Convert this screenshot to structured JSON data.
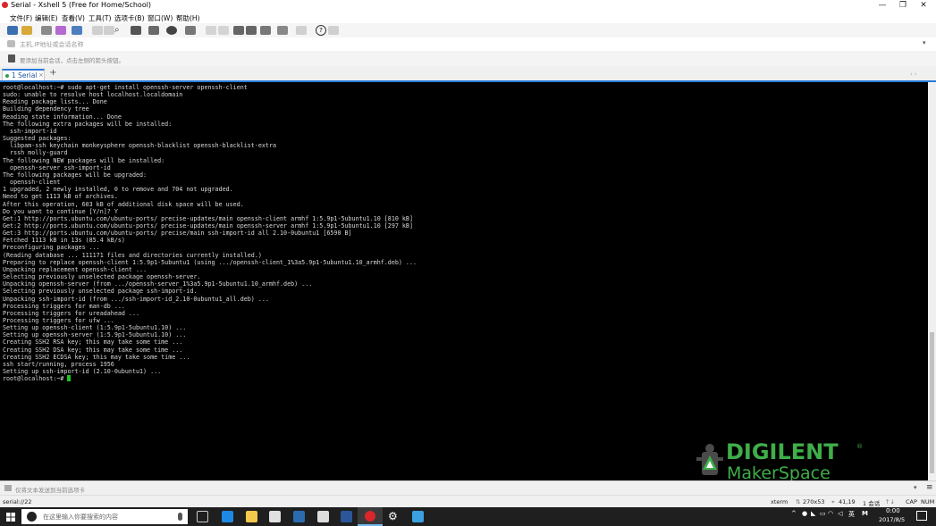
{
  "window": {
    "title": "Serial - Xshell 5 (Free for Home/School)"
  },
  "menu": [
    "文件(F)",
    "编辑(E)",
    "查看(V)",
    "工具(T)",
    "选项卡(B)",
    "窗口(W)",
    "帮助(H)"
  ],
  "address_bar": {
    "placeholder": "主机,IP地址或会话名称"
  },
  "hint_bar": {
    "text": "要添加当前会话，点击左侧的箭头按钮。"
  },
  "tabs": [
    {
      "label": "1 Serial",
      "active": true
    }
  ],
  "terminal": {
    "lines": [
      "root@localhost:~# sudo apt-get install openssh-server openssh-client",
      "sudo: unable to resolve host localhost.localdomain",
      "Reading package lists... Done",
      "Building dependency tree",
      "Reading state information... Done",
      "The following extra packages will be installed:",
      "  ssh-import-id",
      "Suggested packages:",
      "  libpam-ssh keychain monkeysphere openssh-blacklist openssh-blacklist-extra",
      "  rssh molly-guard",
      "The following NEW packages will be installed:",
      "  openssh-server ssh-import-id",
      "The following packages will be upgraded:",
      "  openssh-client",
      "1 upgraded, 2 newly installed, 0 to remove and 704 not upgraded.",
      "Need to get 1113 kB of archives.",
      "After this operation, 603 kB of additional disk space will be used.",
      "Do you want to continue [Y/n]? Y",
      "Get:1 http://ports.ubuntu.com/ubuntu-ports/ precise-updates/main openssh-client armhf 1:5.9p1-5ubuntu1.10 [810 kB]",
      "Get:2 http://ports.ubuntu.com/ubuntu-ports/ precise-updates/main openssh-server armhf 1:5.9p1-5ubuntu1.10 [297 kB]",
      "Get:3 http://ports.ubuntu.com/ubuntu-ports/ precise/main ssh-import-id all 2.10-0ubuntu1 [6590 B]",
      "Fetched 1113 kB in 13s (85.4 kB/s)",
      "Preconfiguring packages ...",
      "(Reading database ... 111171 files and directories currently installed.)",
      "Preparing to replace openssh-client 1:5.9p1-5ubuntu1 (using .../openssh-client_1%3a5.9p1-5ubuntu1.10_armhf.deb) ...",
      "Unpacking replacement openssh-client ...",
      "Selecting previously unselected package openssh-server.",
      "Unpacking openssh-server (from .../openssh-server_1%3a5.9p1-5ubuntu1.10_armhf.deb) ...",
      "Selecting previously unselected package ssh-import-id.",
      "Unpacking ssh-import-id (from .../ssh-import-id_2.10-0ubuntu1_all.deb) ...",
      "Processing triggers for man-db ...",
      "Processing triggers for ureadahead ...",
      "Processing triggers for ufw ...",
      "Setting up openssh-client (1:5.9p1-5ubuntu1.10) ...",
      "Setting up openssh-server (1:5.9p1-5ubuntu1.10) ...",
      "Creating SSH2 RSA key; this may take some time ...",
      "Creating SSH2 DSA key; this may take some time ...",
      "Creating SSH2 ECDSA key; this may take some time ...",
      "ssh start/running, process 1956",
      "Setting up ssh-import-id (2.10-0ubuntu1) ..."
    ],
    "prompt": "root@localhost:~# "
  },
  "logo": {
    "line1": "DIGILENT",
    "line2": "MakerSpace",
    "mark": "®"
  },
  "compose": {
    "placeholder": "仅将文本发送到当前选项卡"
  },
  "status": {
    "connection": "serial://22",
    "term": "xterm",
    "size": "270x53",
    "position": "41,19",
    "sessions": "1 会话",
    "caps": "CAP",
    "num": "NUM"
  },
  "taskbar": {
    "search_placeholder": "在这里输入你要搜索的内容",
    "tray_lang": "英",
    "time": "0:00",
    "date": "2017/8/5"
  },
  "colors": {
    "accent": "#2a7bd6",
    "terminal_bg": "#000000",
    "cursor": "#1ec61e",
    "logo_green": "#3fae49"
  }
}
